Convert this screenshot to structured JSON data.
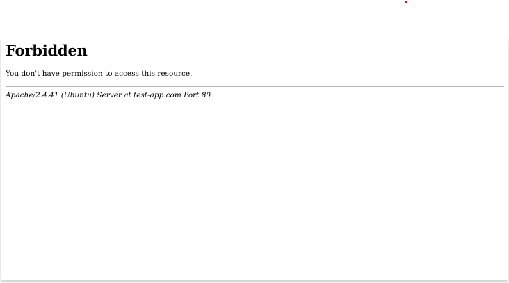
{
  "error_page": {
    "title": "Forbidden",
    "message": "You don't have permission to access this resource.",
    "server_signature": "Apache/2.4.41 (Ubuntu) Server at test-app.com Port 80"
  },
  "colors": {
    "background": "#ffffff",
    "text": "#000000",
    "divider": "#b9b9b9",
    "red_marker": "#cc1b1b"
  },
  "icons": {
    "top_marker": "red-dot-icon"
  }
}
